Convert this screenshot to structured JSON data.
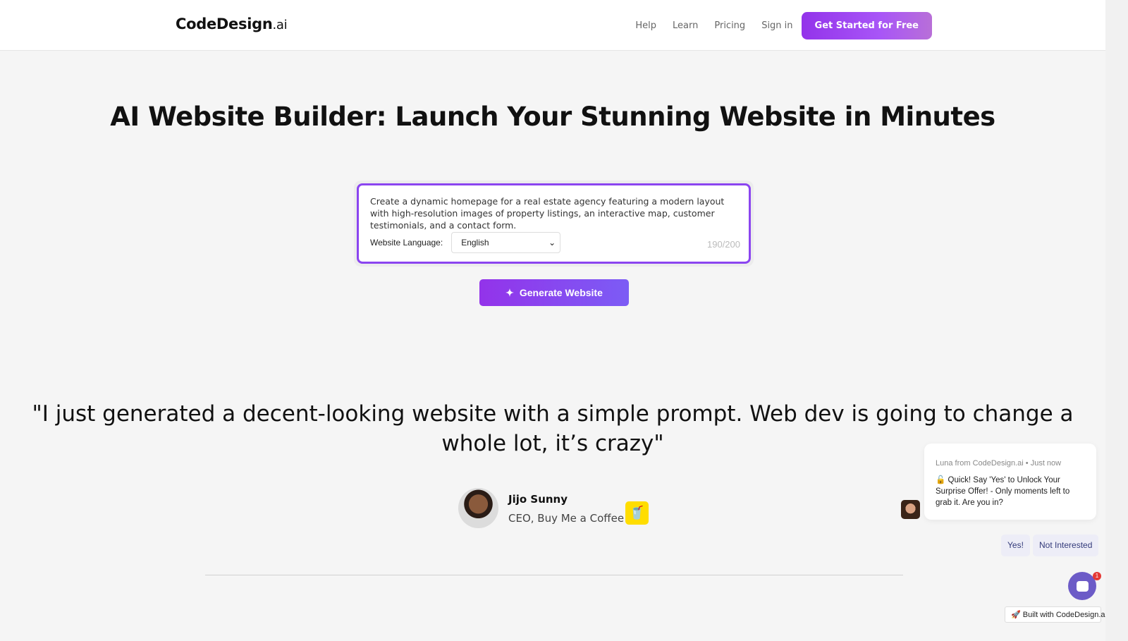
{
  "header": {
    "logo_main": "CodeDesign",
    "logo_suffix": ".ai",
    "nav": [
      "Help",
      "Learn",
      "Pricing",
      "Sign in"
    ],
    "cta": "Get Started for Free"
  },
  "hero": {
    "title": "AI Website Builder: Launch Your Stunning Website in Minutes",
    "prompt": "Create a dynamic homepage for a real estate agency featuring a modern layout with high-resolution images of property listings, an interactive map, customer testimonials, and a contact form.",
    "language_label": "Website Language:",
    "language_value": "English",
    "char_count": "190/200",
    "generate_label": "Generate Website"
  },
  "testimonial": {
    "quote": "\"I just generated a decent-looking website with a simple prompt. Web dev is going to change a whole lot, it’s crazy\"",
    "name": "Jijo Sunny",
    "role": "CEO, Buy Me a Coffee"
  },
  "chat": {
    "meta": "Luna from CodeDesign.ai • Just now",
    "message": "🔓 Quick! Say 'Yes' to Unlock Your Surprise Offer! - Only moments left to grab it. Are you in?",
    "yes": "Yes!",
    "no": "Not Interested",
    "badge": "1"
  },
  "built_with": "🚀 Built with CodeDesign.ai",
  "colors": {
    "accent": "#9333ea",
    "border": "#8b45f0"
  }
}
